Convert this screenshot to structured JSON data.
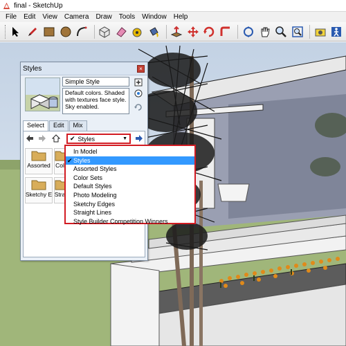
{
  "window": {
    "title": "final - SketchUp"
  },
  "menu": [
    "File",
    "Edit",
    "View",
    "Camera",
    "Draw",
    "Tools",
    "Window",
    "Help"
  ],
  "toolbar": {
    "tools": [
      "select-arrow-icon",
      "pencil-line-icon",
      "rectangle-icon",
      "circle-icon",
      "arc-icon",
      "make-component-icon",
      "eraser-icon",
      "tape-measure-icon",
      "paint-bucket-icon",
      "push-pull-icon",
      "move-icon",
      "rotate-icon",
      "follow-me-icon",
      "orbit-icon",
      "pan-icon",
      "zoom-icon",
      "zoom-extents-icon",
      "position-camera-icon",
      "walk-icon"
    ]
  },
  "styles_panel": {
    "title": "Styles",
    "style_name": "Simple Style",
    "style_description": "Default colors.  Shaded with textures face style.  Sky enabled.",
    "tabs": [
      "Select",
      "Edit",
      "Mix"
    ],
    "active_tab": "Select",
    "library_select": "Styles",
    "folders": [
      "Assorted",
      "Col",
      "Sketchy E",
      "Stra"
    ],
    "dropdown": {
      "items": [
        "In Model",
        "Styles",
        "Assorted Styles",
        "Color Sets",
        "Default Styles",
        "Photo Modeling",
        "Sketchy Edges",
        "Straight Lines",
        "Style Builder Competition Winners"
      ],
      "selected": "Styles"
    }
  },
  "colors": {
    "highlight": "#d21b22",
    "selection": "#3399ff",
    "panel_bg": "#eaf0f7"
  }
}
